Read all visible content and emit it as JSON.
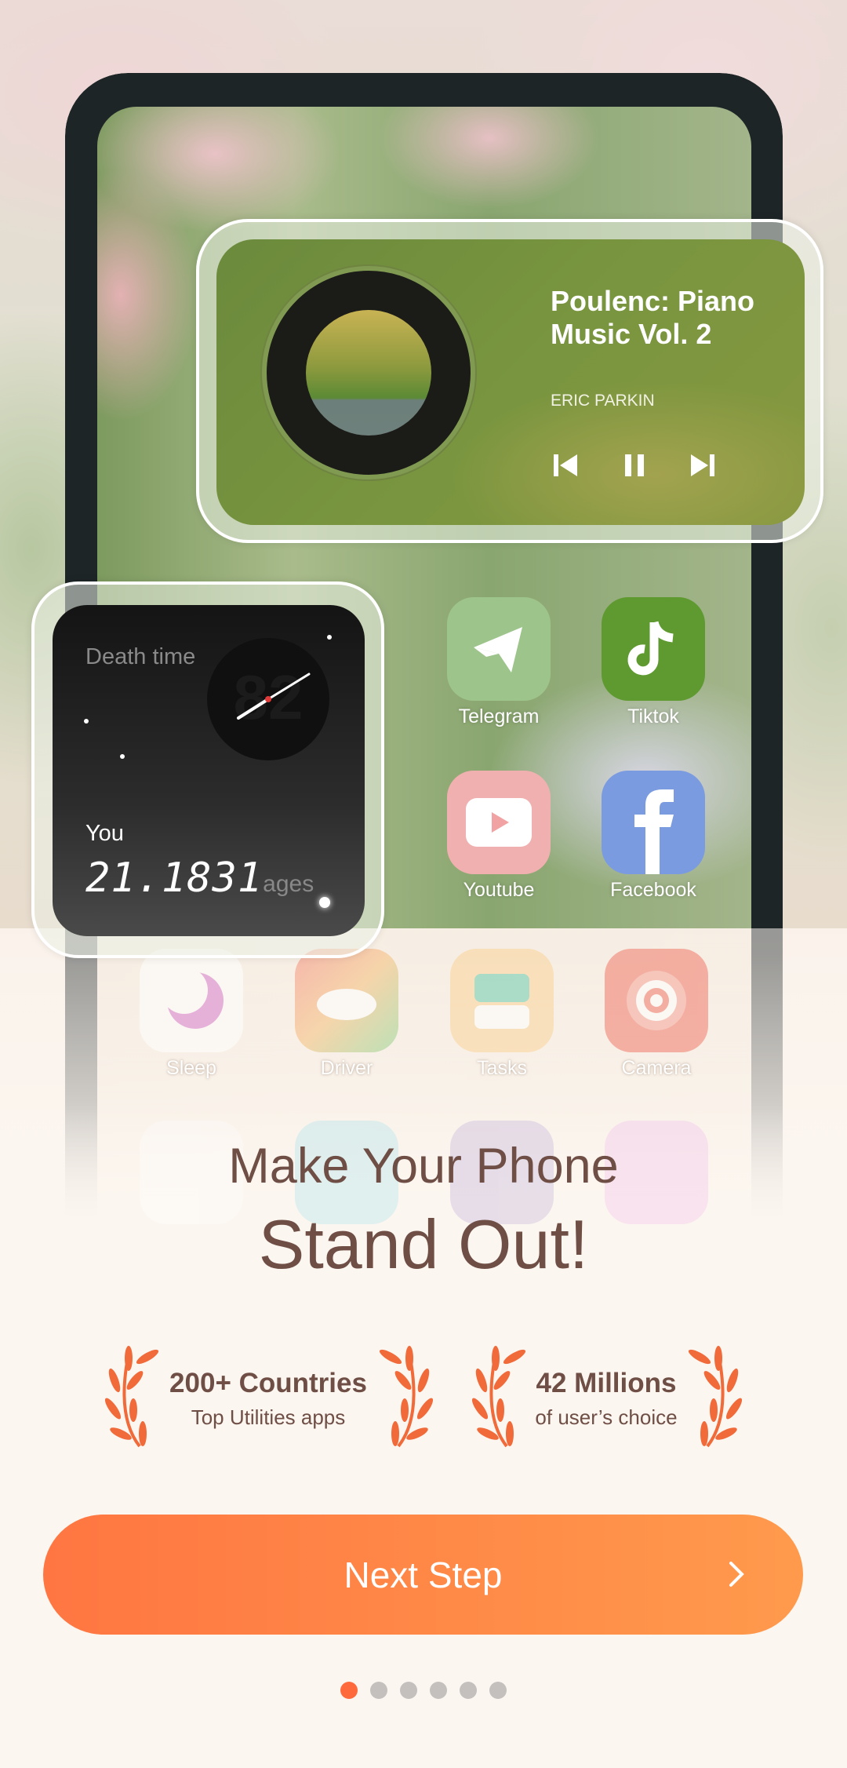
{
  "music_widget": {
    "title_line1": "Poulenc: Piano",
    "title_line2": "Music Vol. 2",
    "artist": "ERIC PARKIN",
    "controls": [
      "previous-icon",
      "pause-icon",
      "next-icon"
    ]
  },
  "death_widget": {
    "label": "Death time",
    "clock_number": "82",
    "you_label": "You",
    "value": "21.1831",
    "unit": "ages"
  },
  "apps": [
    {
      "label": "Telegram",
      "color": "#9dc48b"
    },
    {
      "label": "Tiktok",
      "color": "#5f9a31"
    },
    {
      "label": "Youtube",
      "color": "#f1b0b0"
    },
    {
      "label": "Facebook",
      "color": "#7b9be0"
    }
  ],
  "faded_apps": [
    {
      "label": "Sleep"
    },
    {
      "label": "Driver"
    },
    {
      "label": "Tasks"
    },
    {
      "label": "Camera"
    }
  ],
  "headline": {
    "line1": "Make Your Phone",
    "line2": "Stand Out!"
  },
  "stats": [
    {
      "title": "200+ Countries",
      "subtitle": "Top Utilities apps"
    },
    {
      "title": "42 Millions",
      "subtitle": "of user’s choice"
    }
  ],
  "next_button": {
    "label": "Next Step"
  },
  "pagination": {
    "total": 6,
    "current": 1
  },
  "colors": {
    "accent": "#ff7642",
    "text": "#6e4e45",
    "laurel": "#f06a3a"
  }
}
